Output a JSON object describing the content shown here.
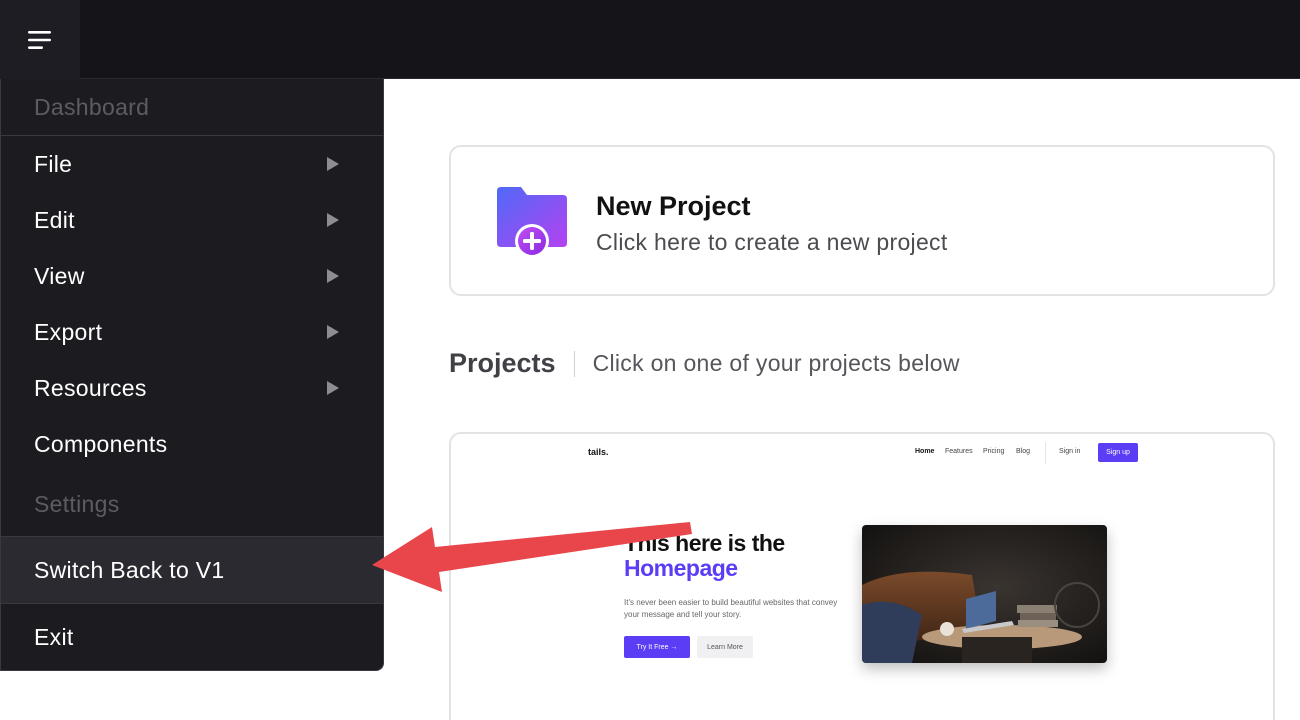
{
  "menu": {
    "items": [
      {
        "label": "Dashboard",
        "disabled": true,
        "submenu": false
      },
      {
        "label": "File",
        "disabled": false,
        "submenu": true
      },
      {
        "label": "Edit",
        "disabled": false,
        "submenu": true
      },
      {
        "label": "View",
        "disabled": false,
        "submenu": true
      },
      {
        "label": "Export",
        "disabled": false,
        "submenu": true
      },
      {
        "label": "Resources",
        "disabled": false,
        "submenu": true
      },
      {
        "label": "Components",
        "disabled": false,
        "submenu": false
      },
      {
        "label": "Settings",
        "disabled": true,
        "submenu": false
      },
      {
        "label": "Switch Back to V1",
        "disabled": false,
        "submenu": false,
        "highlighted": true
      },
      {
        "label": "Exit",
        "disabled": false,
        "submenu": false
      }
    ]
  },
  "new_project": {
    "title": "New Project",
    "subtitle": "Click here to create a new project",
    "icon": "folder-plus-icon"
  },
  "projects": {
    "title": "Projects",
    "subtitle": "Click on one of your projects below"
  },
  "preview": {
    "logo": "tails.",
    "nav": [
      "Home",
      "Features",
      "Pricing",
      "Blog"
    ],
    "sign_in": "Sign in",
    "sign_up": "Sign up",
    "headline_1": "This here is the",
    "headline_2": "Homepage",
    "paragraph": "It's never been easier to build beautiful websites that convey your message and tell your story.",
    "cta_primary": "Try It Free →",
    "cta_secondary": "Learn More"
  },
  "colors": {
    "accent": "#5b3df5",
    "annotation_arrow": "#e8464b",
    "menu_bg": "#1c1b20",
    "topbar_bg": "#151419"
  }
}
